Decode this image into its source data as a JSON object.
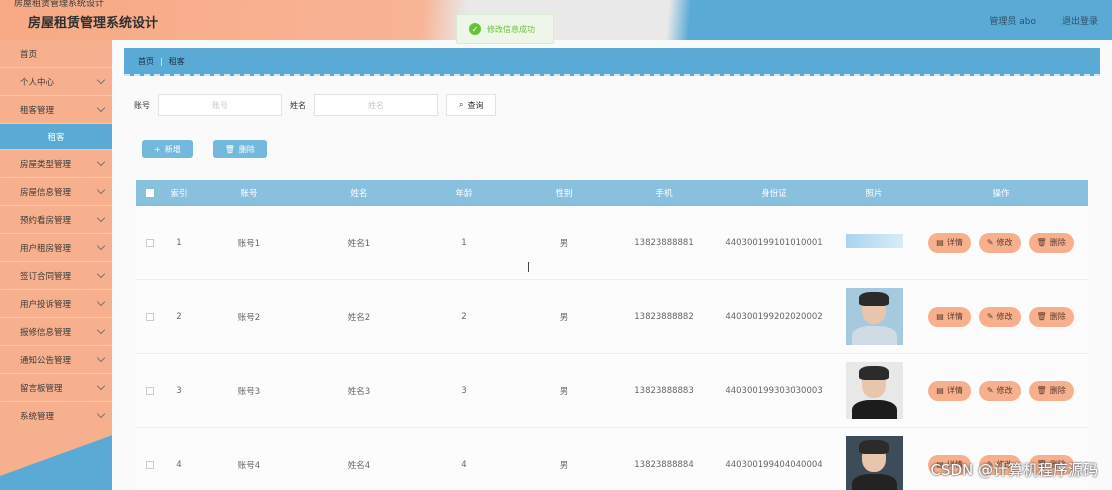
{
  "header": {
    "top_title": "房屋租赁管理系统设计",
    "system_title": "房屋租赁管理系统设计",
    "user_label": "管理员 abo",
    "logout_label": "退出登录"
  },
  "toast": {
    "message": "修改信息成功"
  },
  "sidebar": {
    "items": [
      {
        "label": "首页",
        "has_children": false
      },
      {
        "label": "个人中心",
        "has_children": true
      },
      {
        "label": "租客管理",
        "has_children": true
      },
      {
        "label": "租客",
        "has_children": false,
        "sub": true
      },
      {
        "label": "房屋类型管理",
        "has_children": true
      },
      {
        "label": "房屋信息管理",
        "has_children": true
      },
      {
        "label": "预约看房管理",
        "has_children": true
      },
      {
        "label": "用户租房管理",
        "has_children": true
      },
      {
        "label": "签订合同管理",
        "has_children": true
      },
      {
        "label": "用户投诉管理",
        "has_children": true
      },
      {
        "label": "报修信息管理",
        "has_children": true
      },
      {
        "label": "通知公告管理",
        "has_children": true
      },
      {
        "label": "留言板管理",
        "has_children": true
      },
      {
        "label": "系统管理",
        "has_children": true
      }
    ]
  },
  "breadcrumb": {
    "home": "首页",
    "current": "租客"
  },
  "search": {
    "account_label": "账号",
    "account_placeholder": "账号",
    "name_label": "姓名",
    "name_placeholder": "姓名",
    "query_label": "查询"
  },
  "actions": {
    "add_label": "新增",
    "delete_label": "删除"
  },
  "table": {
    "columns": [
      "索引",
      "账号",
      "姓名",
      "年龄",
      "性别",
      "手机",
      "身份证",
      "照片",
      "操作"
    ],
    "rows": [
      {
        "index": "1",
        "account": "账号1",
        "name": "姓名1",
        "age": "1",
        "gender": "男",
        "phone": "13823888881",
        "id_card": "440300199101010001",
        "photo": "photo-1"
      },
      {
        "index": "2",
        "account": "账号2",
        "name": "姓名2",
        "age": "2",
        "gender": "男",
        "phone": "13823888882",
        "id_card": "440300199202020002",
        "photo": "photo-2"
      },
      {
        "index": "3",
        "account": "账号3",
        "name": "姓名3",
        "age": "3",
        "gender": "男",
        "phone": "13823888883",
        "id_card": "440300199303030003",
        "photo": "photo-3"
      },
      {
        "index": "4",
        "account": "账号4",
        "name": "姓名4",
        "age": "4",
        "gender": "男",
        "phone": "13823888884",
        "id_card": "440300199404040004",
        "photo": "photo-4"
      }
    ],
    "ops": {
      "detail": "详情",
      "edit": "修改",
      "delete": "删除"
    }
  },
  "watermark": "CSDN @计算机程序源码",
  "colors": {
    "accent_orange": "#f7b08e",
    "accent_blue": "#5aaad6",
    "table_header": "#89c0de"
  }
}
